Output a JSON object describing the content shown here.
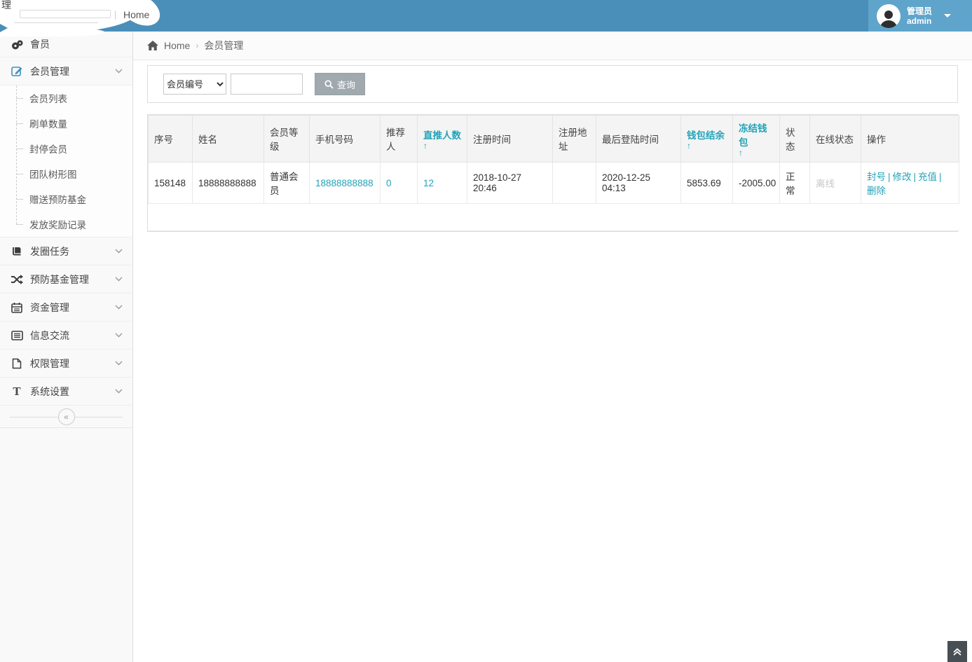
{
  "colors": {
    "topbar": "#4a8fb9",
    "topbar_light": "#5fa4cb",
    "accent_teal": "#23a3b8",
    "button_gray": "#a0a9ae"
  },
  "topbar": {
    "home_tab": "Home",
    "tab_separator": "|",
    "corner_fragment": "理",
    "admin": {
      "role": "管理员",
      "name": "admin"
    }
  },
  "breadcrumb": {
    "home": "Home",
    "separator": "›",
    "current": "会员管理"
  },
  "search": {
    "field_select": "会员编号",
    "input_value": "",
    "button_label": "查询"
  },
  "sidebar": {
    "items": [
      {
        "label": "會员"
      },
      {
        "label": "会员管理",
        "children": [
          "会员列表",
          "刷单数量",
          "封停会员",
          "团队树形图",
          "赠送预防基金",
          "发放奖励记录"
        ]
      },
      {
        "label": "发圈任务"
      },
      {
        "label": "预防基金管理"
      },
      {
        "label": "资金管理"
      },
      {
        "label": "信息交流"
      },
      {
        "label": "权限管理"
      },
      {
        "label": "系统设置"
      }
    ],
    "collapse_glyph": "«"
  },
  "table": {
    "sort_arrow": "↑",
    "columns": [
      {
        "label": "序号"
      },
      {
        "label": "姓名"
      },
      {
        "label": "会员等级"
      },
      {
        "label": "手机号码"
      },
      {
        "label": "推荐人"
      },
      {
        "label": "直推人数",
        "sortable": true
      },
      {
        "label": "注册时间"
      },
      {
        "label": "注册地址"
      },
      {
        "label": "最后登陆时间"
      },
      {
        "label": "钱包结余",
        "sortable": true
      },
      {
        "label": "冻结钱包",
        "sortable": true
      },
      {
        "label": "状态"
      },
      {
        "label": "在线状态"
      },
      {
        "label": "操作"
      }
    ],
    "action_separator": "|",
    "rows": [
      {
        "seq": "158148",
        "name": "18888888888",
        "level": "普通会员",
        "phone": "18888888888",
        "referrer": "0",
        "direct_count": "12",
        "reg_time": "2018-10-27 20:46",
        "reg_address": "",
        "last_login": "2020-12-25 04:13",
        "wallet_balance": "5853.69",
        "frozen_wallet": "-2005.00",
        "status": "正常",
        "online_status": "离线",
        "actions": [
          "封号",
          "修改",
          "充值",
          "删除"
        ]
      }
    ]
  }
}
